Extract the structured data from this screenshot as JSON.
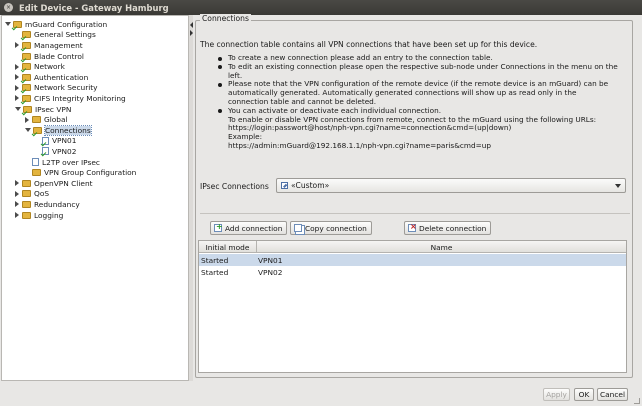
{
  "window": {
    "title": "Edit Device - Gateway Hamburg",
    "close_symbol": "×"
  },
  "tree": [
    {
      "label": "mGuard Configuration",
      "handle": "open",
      "icon": "folder-check-icon",
      "check": true,
      "depth": 0
    },
    {
      "label": "General Settings",
      "handle": "none",
      "icon": "folder-check-icon",
      "check": true,
      "depth": 1
    },
    {
      "label": "Management",
      "handle": "closed",
      "icon": "folder-icon",
      "check": true,
      "depth": 1
    },
    {
      "label": "Blade Control",
      "handle": "none",
      "icon": "folder-icon",
      "check": true,
      "depth": 1
    },
    {
      "label": "Network",
      "handle": "closed",
      "icon": "folder-icon",
      "check": true,
      "depth": 1
    },
    {
      "label": "Authentication",
      "handle": "closed",
      "icon": "folder-icon",
      "check": true,
      "depth": 1
    },
    {
      "label": "Network Security",
      "handle": "closed",
      "icon": "folder-icon",
      "check": true,
      "depth": 1
    },
    {
      "label": "CIFS Integrity Monitoring",
      "handle": "closed",
      "icon": "folder-icon",
      "check": true,
      "depth": 1
    },
    {
      "label": "IPsec VPN",
      "handle": "open",
      "icon": "folder-icon",
      "check": true,
      "depth": 1
    },
    {
      "label": "Global",
      "handle": "closed",
      "icon": "folder-icon",
      "check": false,
      "depth": 2
    },
    {
      "label": "Connections",
      "handle": "open",
      "icon": "folder-icon",
      "check": true,
      "depth": 2,
      "selected": true
    },
    {
      "label": "VPN01",
      "handle": "none",
      "icon": "doc-check-icon",
      "check": true,
      "depth": 3
    },
    {
      "label": "VPN02",
      "handle": "none",
      "icon": "doc-check-icon",
      "check": true,
      "depth": 3
    },
    {
      "label": "L2TP over IPsec",
      "handle": "none",
      "icon": "doc-icon",
      "check": false,
      "depth": 2
    },
    {
      "label": "VPN Group Configuration",
      "handle": "none",
      "icon": "folder-icon",
      "check": false,
      "depth": 2
    },
    {
      "label": "OpenVPN Client",
      "handle": "closed",
      "icon": "folder-icon",
      "check": false,
      "depth": 1
    },
    {
      "label": "QoS",
      "handle": "closed",
      "icon": "folder-icon",
      "check": false,
      "depth": 1
    },
    {
      "label": "Redundancy",
      "handle": "closed",
      "icon": "folder-icon",
      "check": false,
      "depth": 1
    },
    {
      "label": "Logging",
      "handle": "closed",
      "icon": "folder-icon",
      "check": false,
      "depth": 1
    }
  ],
  "panel": {
    "legend": "Connections",
    "intro": "The connection table contains all VPN connections that have been set up for this device.",
    "bullets": [
      {
        "text": "To create a new connection please add an entry to the connection table."
      },
      {
        "text": "To edit an existing connection please open the respective sub-node under Connections in the menu on the left."
      },
      {
        "text": "Please note that the VPN configuration of the remote device (if the remote device is an mGuard) can be automatically generated. Automatically generated connections will show up as read only in the connection table and cannot be deleted."
      },
      {
        "text": "You can activate or deactivate each individual connection."
      }
    ],
    "remote_lines": [
      "To enable or disable VPN connections from remote, connect to the mGuard using the following URLs:",
      "https://login:passwort@host/nph-vpn.cgi?name=connection&cmd=(up|down)",
      "Example:",
      "https://admin:mGuard@192.168.1.1/nph-vpn.cgi?name=paris&cmd=up"
    ],
    "ipsec_label": "IPsec Connections",
    "ipsec_value": "«Custom»"
  },
  "buttons": {
    "add": "Add connection",
    "copy": "Copy connection",
    "delete": "Delete connection"
  },
  "table": {
    "columns": [
      "Initial mode",
      "Name"
    ],
    "rows": [
      {
        "mode": "Started",
        "name": "VPN01",
        "selected": true
      },
      {
        "mode": "Started",
        "name": "VPN02",
        "selected": false
      }
    ]
  },
  "footer": {
    "apply": "Apply",
    "ok": "OK",
    "cancel": "Cancel"
  }
}
